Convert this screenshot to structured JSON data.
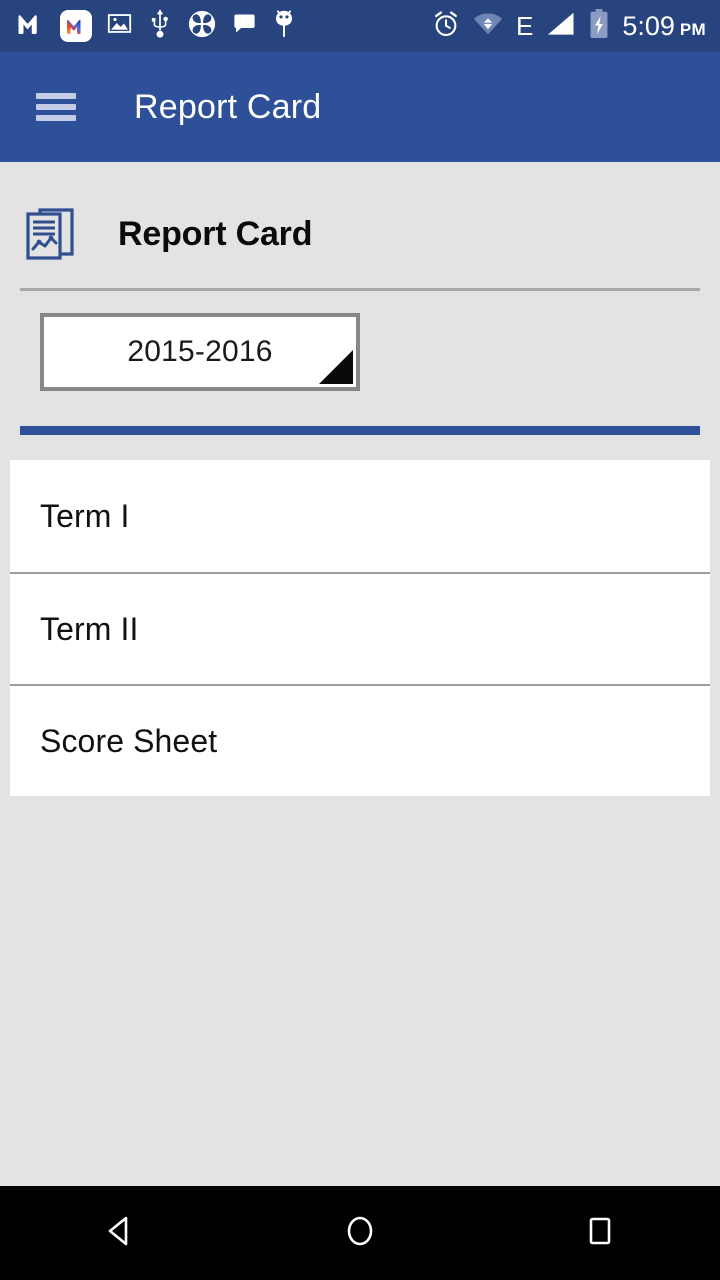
{
  "status_bar": {
    "background_color": "#27447f",
    "time": "5:09",
    "am_pm": "PM",
    "network_type": "E",
    "left_icons": [
      {
        "name": "mail-m-logo-icon",
        "label": "M"
      },
      {
        "name": "mail-m-badge-icon",
        "label": "M"
      },
      {
        "name": "photo-image-icon",
        "label": "Image"
      },
      {
        "name": "usb-icon",
        "label": "USB"
      },
      {
        "name": "flower-clover-icon",
        "label": "Clover"
      },
      {
        "name": "chat-bubble-icon",
        "label": "Chat"
      },
      {
        "name": "android-debug-icon",
        "label": "Android"
      }
    ],
    "right_icons": [
      {
        "name": "alarm-clock-icon",
        "label": "Alarm"
      },
      {
        "name": "wifi-icon",
        "label": "Wi-Fi"
      },
      {
        "name": "network-type-label",
        "label": "E"
      },
      {
        "name": "signal-bars-icon",
        "label": "Signal"
      },
      {
        "name": "battery-charging-icon",
        "label": "Battery charging"
      }
    ]
  },
  "app_bar": {
    "background_color": "#2d5099",
    "menu_label": "Menu",
    "title": "Report Card"
  },
  "page": {
    "background_color": "#e3e3e3",
    "heading": "Report Card",
    "heading_icon": "report-document-chart-icon",
    "accent_color": "#2d5099",
    "divider_color": "#a9a9a9"
  },
  "session_spinner": {
    "name": "academic-year-spinner",
    "selected_value": "2015-2016",
    "options": [
      "2015-2016"
    ]
  },
  "list": {
    "items": [
      {
        "label": "Term I"
      },
      {
        "label": "Term II"
      },
      {
        "label": "Score Sheet"
      }
    ]
  },
  "nav_bar": {
    "background_color": "#000000",
    "back_label": "Back",
    "home_label": "Home",
    "recents_label": "Recents"
  }
}
